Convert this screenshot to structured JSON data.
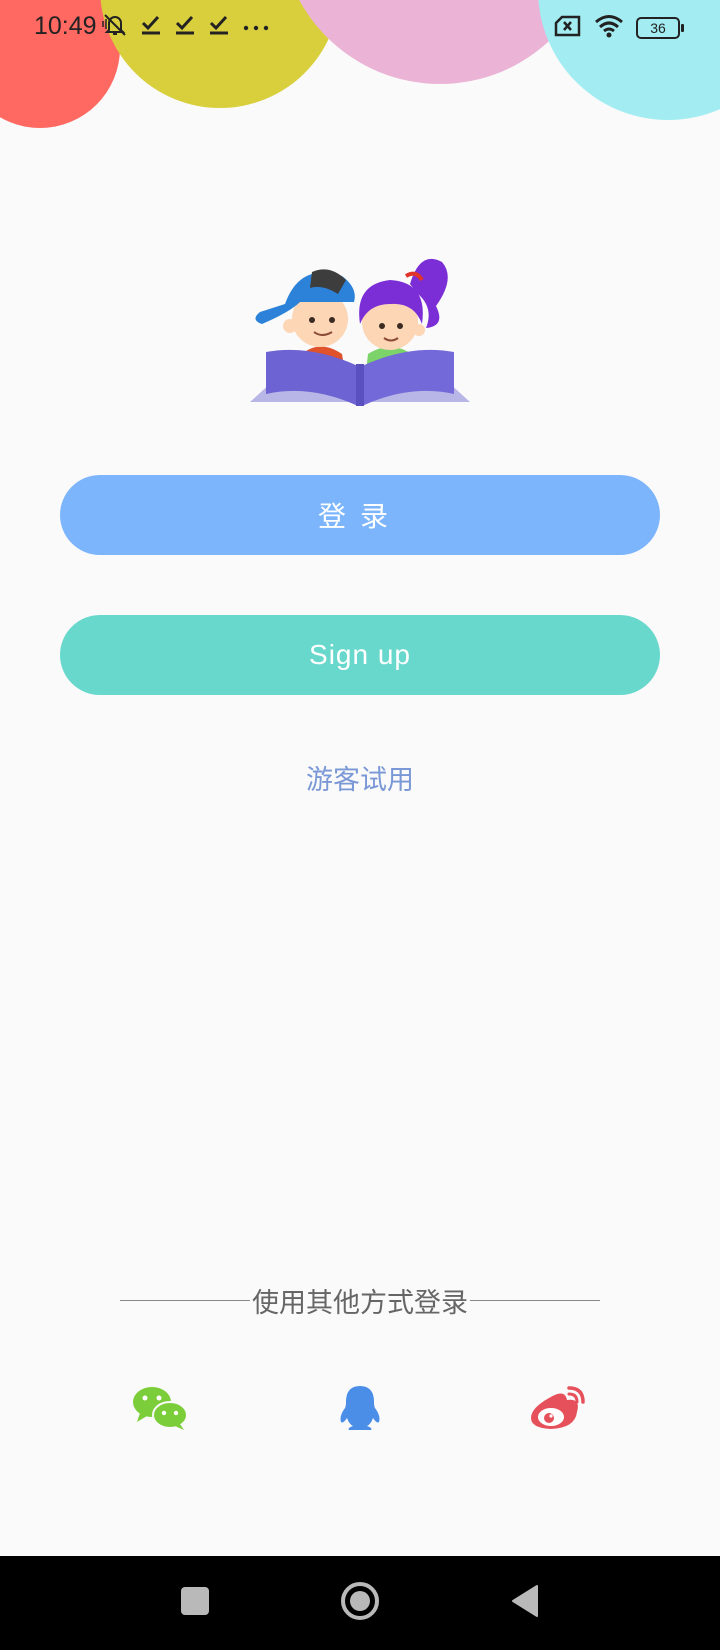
{
  "status_bar": {
    "time": "10:49",
    "battery_level": "36",
    "left_icons": [
      "mute-bell-icon",
      "check-icon",
      "check-icon",
      "check-icon",
      "more-dots-icon"
    ],
    "right_icons": [
      "sim-error-icon",
      "wifi-icon",
      "battery-icon"
    ]
  },
  "decor": {
    "bubble_colors": [
      "#ff6961",
      "#d9cf3d",
      "#ebb4d6",
      "#a3edf2"
    ]
  },
  "buttons": {
    "login_label": "登录",
    "signup_label": "Sign up",
    "login_color": "#7cb5fc",
    "signup_color": "#69d8cc"
  },
  "guest_link": "游客试用",
  "other_login": {
    "label": "使用其他方式登录",
    "methods": [
      {
        "icon": "wechat-icon",
        "color": "#7bce3a"
      },
      {
        "icon": "qq-icon",
        "color": "#4a8ee8"
      },
      {
        "icon": "weibo-icon",
        "color": "#e6505a"
      }
    ]
  },
  "nav_bar": {
    "buttons": [
      "recent-apps-button",
      "home-button",
      "back-button"
    ]
  }
}
